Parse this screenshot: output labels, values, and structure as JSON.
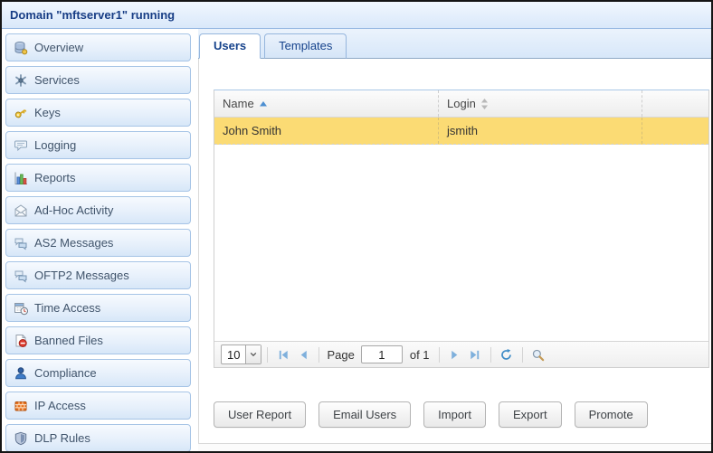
{
  "window": {
    "title": "Domain \"mftserver1\" running"
  },
  "sidebar": {
    "items": [
      {
        "label": "Overview",
        "icon": "database-icon"
      },
      {
        "label": "Services",
        "icon": "services-icon"
      },
      {
        "label": "Keys",
        "icon": "key-icon"
      },
      {
        "label": "Logging",
        "icon": "speech-bubble-icon"
      },
      {
        "label": "Reports",
        "icon": "bar-chart-icon"
      },
      {
        "label": "Ad-Hoc Activity",
        "icon": "envelope-icon"
      },
      {
        "label": "AS2 Messages",
        "icon": "messages-icon"
      },
      {
        "label": "OFTP2 Messages",
        "icon": "messages-icon"
      },
      {
        "label": "Time Access",
        "icon": "calendar-clock-icon"
      },
      {
        "label": "Banned Files",
        "icon": "banned-file-icon"
      },
      {
        "label": "Compliance",
        "icon": "person-icon"
      },
      {
        "label": "IP Access",
        "icon": "firewall-icon"
      },
      {
        "label": "DLP Rules",
        "icon": "shield-icon"
      }
    ]
  },
  "tabs": [
    {
      "label": "Users",
      "active": true
    },
    {
      "label": "Templates",
      "active": false
    }
  ],
  "grid": {
    "columns": [
      {
        "label": "Name",
        "sort": "ascending",
        "sort_icon": "sort-ascending-icon"
      },
      {
        "label": "Login",
        "sort": "unsorted",
        "sort_icon": "sort-both-icon"
      }
    ],
    "rows": [
      {
        "name": "John Smith",
        "login": "jsmith",
        "selected": true
      }
    ],
    "selected_row_color": "#FBDB74"
  },
  "pager": {
    "page_size": "10",
    "page_label": "Page",
    "page_value": "1",
    "of_label": "of 1",
    "icons": [
      "first-page-icon",
      "previous-page-icon",
      "next-page-icon",
      "last-page-icon",
      "refresh-icon",
      "search-icon"
    ]
  },
  "actions": [
    {
      "label": "User Report"
    },
    {
      "label": "Email Users"
    },
    {
      "label": "Import"
    },
    {
      "label": "Export"
    },
    {
      "label": "Promote"
    }
  ],
  "colors": {
    "title_text": "#173D85",
    "accent_blue": "#15428B",
    "pager_icon_blue": "#7FB0DC",
    "refresh_blue": "#3E8CC7",
    "selected_row": "#FBDB74"
  }
}
